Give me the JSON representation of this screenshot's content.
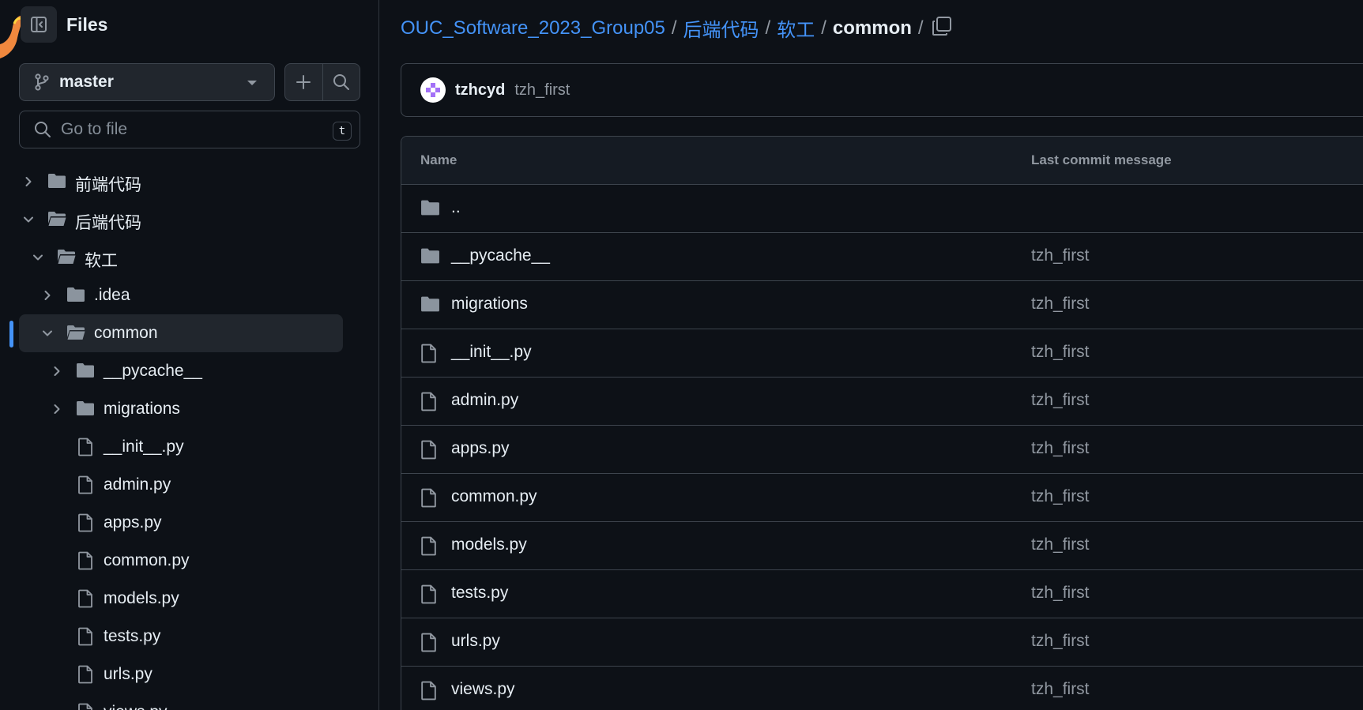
{
  "sidebar": {
    "title": "Files",
    "toggle_icon": "sidebar-collapse-icon",
    "branch": {
      "name": "master",
      "icon": "git-branch-icon"
    },
    "add_icon": "plus-icon",
    "search_icon": "search-icon",
    "search": {
      "placeholder": "Go to file",
      "shortcut": "t"
    },
    "tree": [
      {
        "label": "前端代码",
        "type": "folder",
        "expanded": false,
        "depth": 0
      },
      {
        "label": "后端代码",
        "type": "folder",
        "expanded": true,
        "depth": 0
      },
      {
        "label": "软工",
        "type": "folder",
        "expanded": true,
        "depth": 1
      },
      {
        "label": ".idea",
        "type": "folder",
        "expanded": false,
        "depth": 2
      },
      {
        "label": "common",
        "type": "folder",
        "expanded": true,
        "depth": 2,
        "selected": true
      },
      {
        "label": "__pycache__",
        "type": "folder",
        "expanded": false,
        "depth": 3
      },
      {
        "label": "migrations",
        "type": "folder",
        "expanded": false,
        "depth": 3
      },
      {
        "label": "__init__.py",
        "type": "file",
        "depth": 3
      },
      {
        "label": "admin.py",
        "type": "file",
        "depth": 3
      },
      {
        "label": "apps.py",
        "type": "file",
        "depth": 3
      },
      {
        "label": "common.py",
        "type": "file",
        "depth": 3
      },
      {
        "label": "models.py",
        "type": "file",
        "depth": 3
      },
      {
        "label": "tests.py",
        "type": "file",
        "depth": 3
      },
      {
        "label": "urls.py",
        "type": "file",
        "depth": 3
      },
      {
        "label": "views.py",
        "type": "file",
        "depth": 3
      }
    ]
  },
  "breadcrumb": {
    "repo": "OUC_Software_2023_Group05",
    "parts": [
      "后端代码",
      "软工"
    ],
    "current": "common",
    "separator": "/",
    "copy_icon": "copy-icon"
  },
  "commit": {
    "author": "tzhcyd",
    "message": "tzh_first"
  },
  "table": {
    "headers": {
      "name": "Name",
      "message": "Last commit message"
    },
    "rows": [
      {
        "name": "..",
        "type": "folder",
        "message": ""
      },
      {
        "name": "__pycache__",
        "type": "folder",
        "message": "tzh_first"
      },
      {
        "name": "migrations",
        "type": "folder",
        "message": "tzh_first"
      },
      {
        "name": "__init__.py",
        "type": "file",
        "message": "tzh_first"
      },
      {
        "name": "admin.py",
        "type": "file",
        "message": "tzh_first"
      },
      {
        "name": "apps.py",
        "type": "file",
        "message": "tzh_first"
      },
      {
        "name": "common.py",
        "type": "file",
        "message": "tzh_first"
      },
      {
        "name": "models.py",
        "type": "file",
        "message": "tzh_first"
      },
      {
        "name": "tests.py",
        "type": "file",
        "message": "tzh_first"
      },
      {
        "name": "urls.py",
        "type": "file",
        "message": "tzh_first"
      },
      {
        "name": "views.py",
        "type": "file",
        "message": "tzh_first"
      }
    ]
  },
  "colors": {
    "background": "#0d1117",
    "link": "#4493f8",
    "muted": "#9198a1",
    "border": "#3d444d",
    "folder": "#8b949e"
  }
}
